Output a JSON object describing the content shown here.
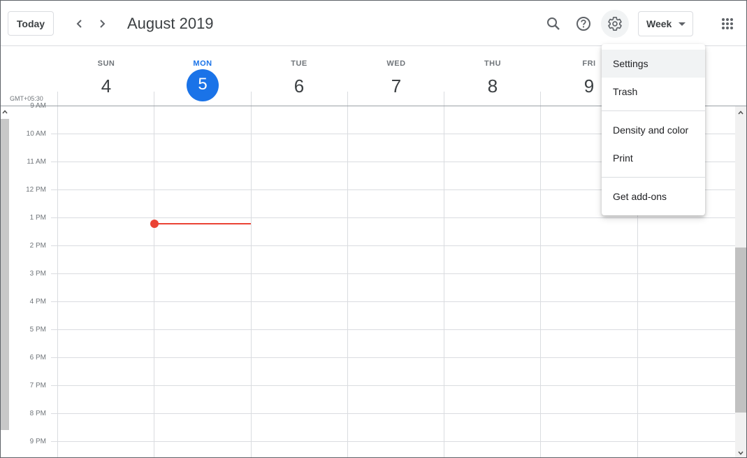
{
  "header": {
    "today_label": "Today",
    "title": "August 2019",
    "view_label": "Week"
  },
  "timezone": "GMT+05:30",
  "days": [
    {
      "dow": "SUN",
      "num": "4"
    },
    {
      "dow": "MON",
      "num": "5"
    },
    {
      "dow": "TUE",
      "num": "6"
    },
    {
      "dow": "WED",
      "num": "7"
    },
    {
      "dow": "THU",
      "num": "8"
    },
    {
      "dow": "FRI",
      "num": "9"
    }
  ],
  "hours": [
    "9 AM",
    "10 AM",
    "11 AM",
    "12 PM",
    "1 PM",
    "2 PM",
    "3 PM",
    "4 PM",
    "5 PM",
    "6 PM",
    "7 PM",
    "8 PM",
    "9 PM"
  ],
  "menu": {
    "settings": "Settings",
    "trash": "Trash",
    "density": "Density and color",
    "print": "Print",
    "addons": "Get add-ons"
  },
  "colors": {
    "accent": "#1a73e8",
    "now": "#ea4335"
  }
}
